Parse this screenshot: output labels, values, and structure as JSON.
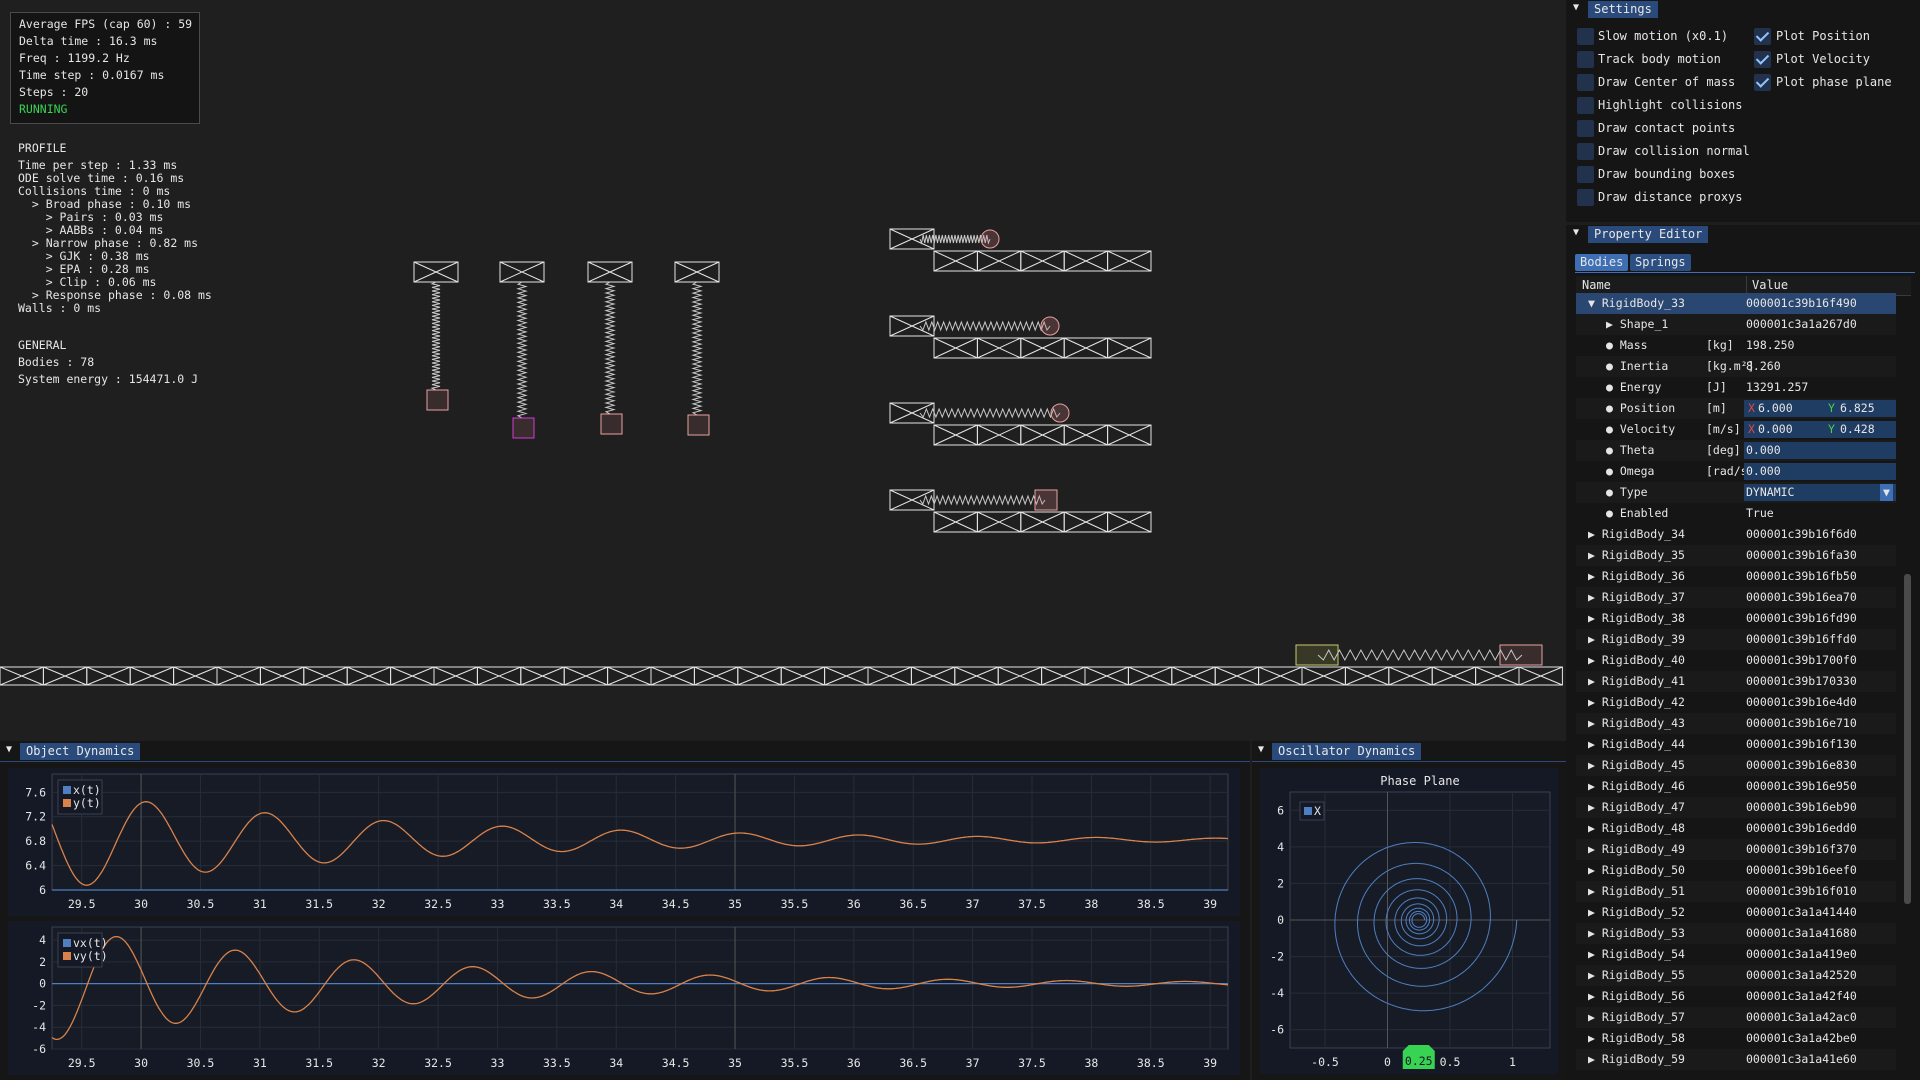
{
  "stats": {
    "lines": [
      "Average FPS (cap 60) : 59",
      "Delta time : 16.3 ms",
      "Freq : 1199.2 Hz",
      "Time step : 0.0167 ms",
      "Steps : 20"
    ],
    "status": "RUNNING",
    "status_color": "#39d353"
  },
  "profile": {
    "title": "PROFILE",
    "lines": [
      "Time per step : 1.33 ms",
      "ODE solve time : 0.16 ms",
      "Collisions time : 0 ms",
      "  > Broad phase : 0.10 ms",
      "    > Pairs : 0.03 ms",
      "    > AABBs : 0.04 ms",
      "  > Narrow phase : 0.82 ms",
      "    > GJK : 0.38 ms",
      "    > EPA : 0.28 ms",
      "    > Clip : 0.06 ms",
      "  > Response phase : 0.08 ms",
      "Walls : 0 ms"
    ]
  },
  "general": {
    "title": "GENERAL",
    "lines": [
      "Bodies : 78",
      "System energy : 154471.0 J"
    ]
  },
  "settings": {
    "title": "Settings",
    "left": [
      {
        "label": "Slow motion (x0.1)",
        "checked": false
      },
      {
        "label": "Track body motion",
        "checked": false
      },
      {
        "label": "Draw Center of mass",
        "checked": false
      },
      {
        "label": "Highlight collisions",
        "checked": false
      },
      {
        "label": "Draw contact points",
        "checked": false
      },
      {
        "label": "Draw collision normal",
        "checked": false
      },
      {
        "label": "Draw bounding boxes",
        "checked": false
      },
      {
        "label": "Draw distance proxys",
        "checked": false
      }
    ],
    "right": [
      {
        "label": "Plot Position",
        "checked": true
      },
      {
        "label": "Plot Velocity",
        "checked": true
      },
      {
        "label": "Plot phase plane",
        "checked": true
      }
    ]
  },
  "property_editor": {
    "title": "Property Editor",
    "tabs": [
      "Bodies",
      "Springs"
    ],
    "col_name": "Name",
    "col_value": "Value",
    "selected": {
      "name": "RigidBody_33",
      "value": "000001c39b16f490"
    },
    "props": [
      {
        "name": "Shape_1",
        "unit": "",
        "value": "000001c3a1a267d0",
        "kind": "expand"
      },
      {
        "name": "Mass",
        "unit": "[kg]",
        "value": "198.250",
        "kind": "text"
      },
      {
        "name": "Inertia",
        "unit": "[kg.m²]",
        "value": "8.260",
        "kind": "text"
      },
      {
        "name": "Energy",
        "unit": "[J]",
        "value": "13291.257",
        "kind": "text"
      },
      {
        "name": "Position",
        "unit": "[m]",
        "x": "6.000",
        "y": "6.825",
        "kind": "xy"
      },
      {
        "name": "Velocity",
        "unit": "[m/s]",
        "x": "0.000",
        "y": "0.428",
        "kind": "xy"
      },
      {
        "name": "Theta",
        "unit": "[deg]",
        "value": "0.000",
        "kind": "input"
      },
      {
        "name": "Omega",
        "unit": "[rad/s]",
        "value": "0.000",
        "kind": "input"
      },
      {
        "name": "Type",
        "unit": "",
        "value": "DYNAMIC",
        "kind": "combo"
      },
      {
        "name": "Enabled",
        "unit": "",
        "value": "True",
        "kind": "text"
      }
    ],
    "x_label": "X",
    "y_label": "Y",
    "bodies": [
      {
        "name": "RigidBody_34",
        "value": "000001c39b16f6d0"
      },
      {
        "name": "RigidBody_35",
        "value": "000001c39b16fa30"
      },
      {
        "name": "RigidBody_36",
        "value": "000001c39b16fb50"
      },
      {
        "name": "RigidBody_37",
        "value": "000001c39b16ea70"
      },
      {
        "name": "RigidBody_38",
        "value": "000001c39b16fd90"
      },
      {
        "name": "RigidBody_39",
        "value": "000001c39b16ffd0"
      },
      {
        "name": "RigidBody_40",
        "value": "000001c39b1700f0"
      },
      {
        "name": "RigidBody_41",
        "value": "000001c39b170330"
      },
      {
        "name": "RigidBody_42",
        "value": "000001c39b16e4d0"
      },
      {
        "name": "RigidBody_43",
        "value": "000001c39b16e710"
      },
      {
        "name": "RigidBody_44",
        "value": "000001c39b16f130"
      },
      {
        "name": "RigidBody_45",
        "value": "000001c39b16e830"
      },
      {
        "name": "RigidBody_46",
        "value": "000001c39b16e950"
      },
      {
        "name": "RigidBody_47",
        "value": "000001c39b16eb90"
      },
      {
        "name": "RigidBody_48",
        "value": "000001c39b16edd0"
      },
      {
        "name": "RigidBody_49",
        "value": "000001c39b16f370"
      },
      {
        "name": "RigidBody_50",
        "value": "000001c39b16eef0"
      },
      {
        "name": "RigidBody_51",
        "value": "000001c39b16f010"
      },
      {
        "name": "RigidBody_52",
        "value": "000001c3a1a41440"
      },
      {
        "name": "RigidBody_53",
        "value": "000001c3a1a41680"
      },
      {
        "name": "RigidBody_54",
        "value": "000001c3a1a419e0"
      },
      {
        "name": "RigidBody_55",
        "value": "000001c3a1a42520"
      },
      {
        "name": "RigidBody_56",
        "value": "000001c3a1a42f40"
      },
      {
        "name": "RigidBody_57",
        "value": "000001c3a1a42ac0"
      },
      {
        "name": "RigidBody_58",
        "value": "000001c3a1a42be0"
      },
      {
        "name": "RigidBody_59",
        "value": "000001c3a1a41e60"
      }
    ]
  },
  "object_dynamics": {
    "title": "Object Dynamics"
  },
  "oscillator_dynamics": {
    "title": "Oscillator Dynamics"
  },
  "colors": {
    "blue": "#4f7fc0",
    "orange": "#d9824a",
    "accent": "#294a7a"
  },
  "chart_data": [
    {
      "type": "line",
      "xticks": [
        "29.5",
        "30",
        "30.5",
        "31",
        "31.5",
        "32",
        "32.5",
        "33",
        "33.5",
        "34",
        "34.5",
        "35",
        "35.5",
        "36",
        "36.5",
        "37",
        "37.5",
        "38",
        "38.5",
        "39"
      ],
      "yticks": [
        "7.6",
        "7.2",
        "6.8",
        "6.4",
        "6"
      ],
      "xlim": [
        29.25,
        39.15
      ],
      "ylim": [
        6.0,
        7.9
      ],
      "series": [
        {
          "name": "x(t)",
          "color": "#4f7fc0",
          "mean": 6.0,
          "amp0": 0.0,
          "decay": 0,
          "period": 1
        },
        {
          "name": "y(t)",
          "color": "#d9824a",
          "mean": 6.82,
          "amp0": 0.82,
          "decay": 0.085,
          "period": 1.0,
          "phase": 0.2
        }
      ]
    },
    {
      "type": "line",
      "xticks": [
        "29.5",
        "30",
        "30.5",
        "31",
        "31.5",
        "32",
        "32.5",
        "33",
        "33.5",
        "34",
        "34.5",
        "35",
        "35.5",
        "36",
        "36.5",
        "37",
        "37.5",
        "38",
        "38.5",
        "39"
      ],
      "yticks": [
        "4",
        "2",
        "0",
        "-2",
        "-4",
        "-6"
      ],
      "xlim": [
        29.25,
        39.15
      ],
      "ylim": [
        -6,
        5.2
      ],
      "series": [
        {
          "name": "vx(t)",
          "color": "#4f7fc0",
          "mean": 0,
          "amp0": 0,
          "decay": 0,
          "period": 1
        },
        {
          "name": "vy(t)",
          "color": "#d9824a",
          "mean": 0,
          "amp0": 5.2,
          "decay": 0.085,
          "period": 1.0,
          "phase": 0.45
        }
      ]
    },
    {
      "type": "scatter",
      "title": "Phase Plane",
      "xticks": [
        "-0.5",
        "0",
        "0.5",
        "1"
      ],
      "yticks": [
        "6",
        "4",
        "2",
        "0",
        "-2",
        "-4",
        "-6"
      ],
      "xlim": [
        -0.78,
        1.3
      ],
      "ylim": [
        -7,
        7
      ],
      "highlight": "0.25",
      "series": [
        {
          "name": "X",
          "color": "#4f7fc0"
        }
      ]
    }
  ]
}
